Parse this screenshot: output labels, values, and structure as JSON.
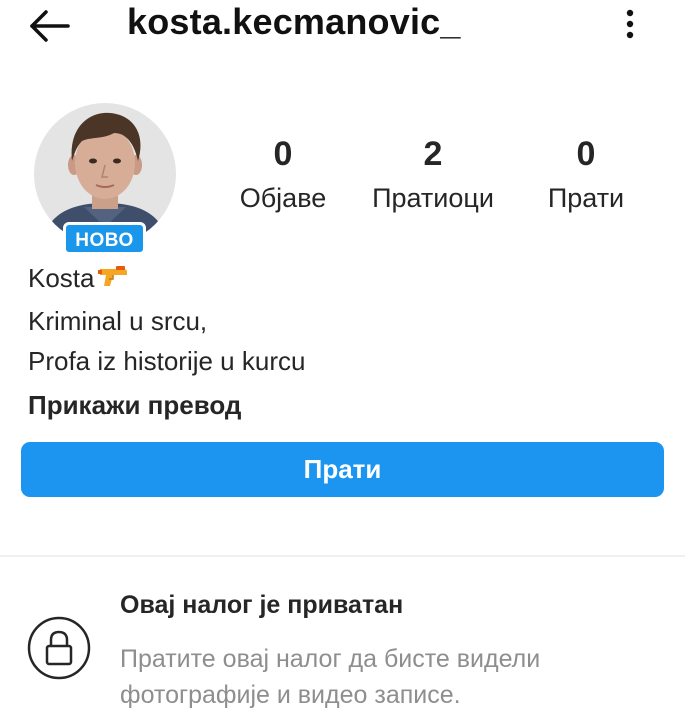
{
  "header": {
    "username": "kosta.kecmanovic_",
    "back_icon": "arrow-left-icon",
    "menu_icon": "more-vertical-icon"
  },
  "profile": {
    "badge": "НОВО",
    "stats": [
      {
        "value": "0",
        "label": "Објаве"
      },
      {
        "value": "2",
        "label": "Пратиоци"
      },
      {
        "value": "0",
        "label": "Прати"
      }
    ]
  },
  "bio": {
    "name": "Kosta",
    "name_emoji_icon": "water-pistol-icon",
    "lines": [
      "Kriminal u srcu,",
      "Profa iz historije u kurcu"
    ],
    "translate_label": "Прикажи превод"
  },
  "actions": {
    "follow_label": "Прати"
  },
  "private_notice": {
    "icon": "lock-icon",
    "title": "Овај налог је приватан",
    "description": "Пратите овај налог да бисте видели фотографије и видео записе."
  },
  "colors": {
    "accent": "#1b95f0",
    "badge": "#1a96ea",
    "text": "#262626",
    "secondary_text": "#8e8e8e",
    "divider": "#efefef"
  }
}
